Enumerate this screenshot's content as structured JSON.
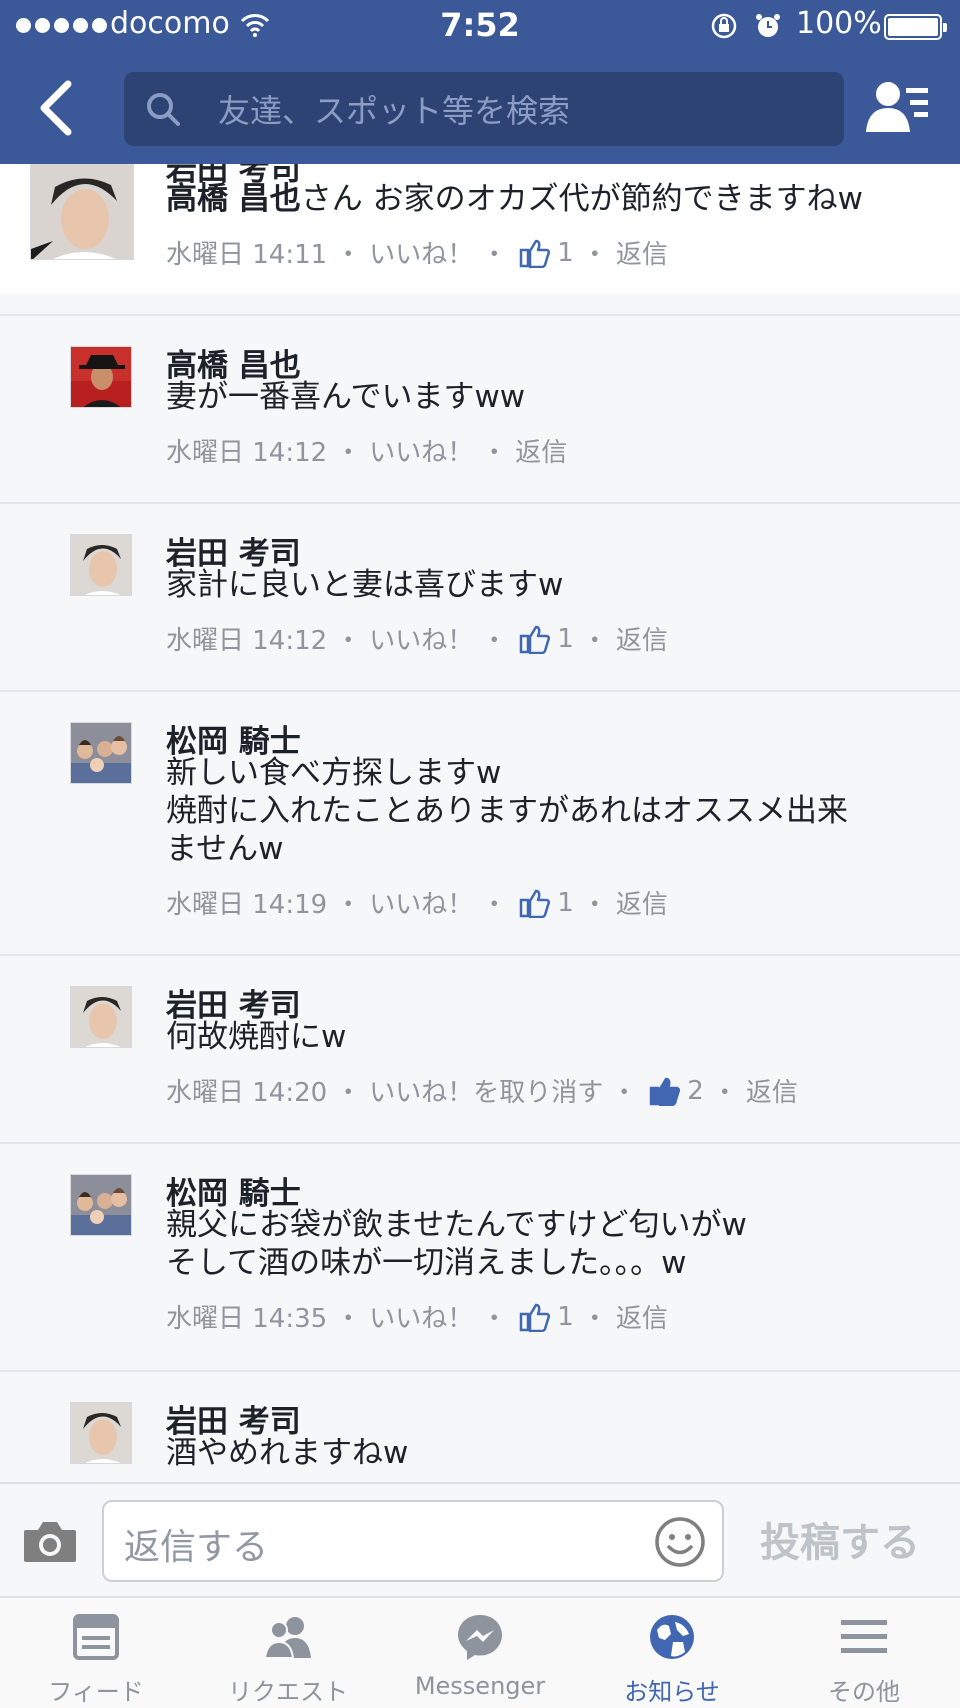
{
  "status_bar": {
    "carrier": "docomo",
    "time": "7:52",
    "battery": "100%"
  },
  "nav": {
    "search_placeholder": "友達、スポット等を検索"
  },
  "comments": [
    {
      "name": "岩田 考司",
      "mention": "高橋 昌也",
      "text": "さん お家のオカズ代が節約できますねw",
      "time": "水曜日 14:11",
      "like_label": "いいね！",
      "likes": "1",
      "reply_label": "返信"
    },
    {
      "name": "高橋 昌也",
      "text": "妻が一番喜んでいますww",
      "time": "水曜日 14:12",
      "like_label": "いいね！",
      "reply_label": "返信"
    },
    {
      "name": "岩田 考司",
      "text": "家計に良いと妻は喜びますw",
      "time": "水曜日 14:12",
      "like_label": "いいね！",
      "likes": "1",
      "reply_label": "返信"
    },
    {
      "name": "松岡 騎士",
      "text_lines": [
        "新しい食べ方探しますw",
        "焼酎に入れたことありますがあれはオススメ出来",
        "ませんw"
      ],
      "time": "水曜日 14:19",
      "like_label": "いいね！",
      "likes": "1",
      "reply_label": "返信"
    },
    {
      "name": "岩田 考司",
      "text": "何故焼酎にw",
      "time": "水曜日 14:20",
      "like_label": "いいね！を取り消す",
      "likes": "2",
      "reply_label": "返信"
    },
    {
      "name": "松岡 騎士",
      "text_lines": [
        "親父にお袋が飲ませたんですけど匂いがw",
        "そして酒の味が一切消えました。。。w"
      ],
      "time": "水曜日 14:35",
      "like_label": "いいね！",
      "likes": "1",
      "reply_label": "返信"
    },
    {
      "name": "岩田 考司",
      "text": "酒やめれますねw"
    }
  ],
  "composer": {
    "placeholder": "返信する",
    "post_label": "投稿する"
  },
  "tabs": [
    {
      "label": "フィード",
      "icon": "feed-icon"
    },
    {
      "label": "リクエスト",
      "icon": "friend-requests-icon"
    },
    {
      "label": "Messenger",
      "icon": "messenger-icon"
    },
    {
      "label": "お知らせ",
      "icon": "globe-icon",
      "active": true
    },
    {
      "label": "その他",
      "icon": "menu-icon"
    }
  ],
  "colors": {
    "brand": "#3b5998",
    "active_tab": "#4267b2",
    "like": "#4267b2"
  }
}
